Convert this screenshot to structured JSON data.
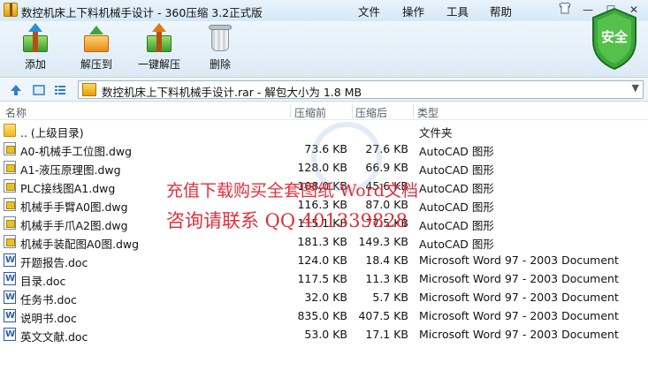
{
  "window": {
    "title": "数控机床上下料机械手设计 - 360压缩 3.2正式版",
    "menu": [
      "文件",
      "操作",
      "工具",
      "帮助"
    ],
    "controls": [
      "shirt-icon",
      "minimize-icon",
      "maximize-icon",
      "close-icon"
    ]
  },
  "toolbar": {
    "buttons": [
      {
        "label": "添加",
        "icon": "add-archive-icon"
      },
      {
        "label": "解压到",
        "icon": "extract-to-icon"
      },
      {
        "label": "一键解压",
        "icon": "one-click-extract-icon"
      },
      {
        "label": "删除",
        "icon": "delete-icon"
      }
    ],
    "security_badge": "安全"
  },
  "address": {
    "text": "数控机床上下料机械手设计.rar - 解包大小为 1.8 MB"
  },
  "columns": [
    "名称",
    "压缩前",
    "压缩后",
    "类型"
  ],
  "rows": [
    {
      "name": ".. (上级目录)",
      "size": "",
      "compressed": "",
      "type": "文件夹",
      "icon": "folder"
    },
    {
      "name": "A0-机械手工位图.dwg",
      "size": "73.6 KB",
      "compressed": "27.6 KB",
      "type": "AutoCAD 图形",
      "icon": "dwg"
    },
    {
      "name": "A1-液压原理图.dwg",
      "size": "128.0 KB",
      "compressed": "66.9 KB",
      "type": "AutoCAD 图形",
      "icon": "dwg"
    },
    {
      "name": "PLC接线图A1.dwg",
      "size": "108.0 KB",
      "compressed": "45.6 KB",
      "type": "AutoCAD 图形",
      "icon": "dwg"
    },
    {
      "name": "机械手手臂A0图.dwg",
      "size": "116.3 KB",
      "compressed": "87.0 KB",
      "type": "AutoCAD 图形",
      "icon": "dwg"
    },
    {
      "name": "机械手手爪A2图.dwg",
      "size": "115.1 KB",
      "compressed": "77.5 KB",
      "type": "AutoCAD 图形",
      "icon": "dwg"
    },
    {
      "name": "机械手装配图A0图.dwg",
      "size": "181.3 KB",
      "compressed": "149.3 KB",
      "type": "AutoCAD 图形",
      "icon": "dwg"
    },
    {
      "name": "开题报告.doc",
      "size": "124.0 KB",
      "compressed": "18.4 KB",
      "type": "Microsoft Word 97 - 2003 Document",
      "icon": "doc"
    },
    {
      "name": "目录.doc",
      "size": "117.5 KB",
      "compressed": "11.3 KB",
      "type": "Microsoft Word 97 - 2003 Document",
      "icon": "doc"
    },
    {
      "name": "任务书.doc",
      "size": "32.0 KB",
      "compressed": "5.7 KB",
      "type": "Microsoft Word 97 - 2003 Document",
      "icon": "doc"
    },
    {
      "name": "说明书.doc",
      "size": "835.0 KB",
      "compressed": "407.5 KB",
      "type": "Microsoft Word 97 - 2003 Document",
      "icon": "doc"
    },
    {
      "name": "英文文献.doc",
      "size": "53.0 KB",
      "compressed": "17.1 KB",
      "type": "Microsoft Word 97 - 2003 Document",
      "icon": "doc"
    }
  ],
  "watermark": {
    "line1": "充值下载购买全套图纸 Word文档",
    "line2": "咨询请联系 QQ 401339828"
  }
}
